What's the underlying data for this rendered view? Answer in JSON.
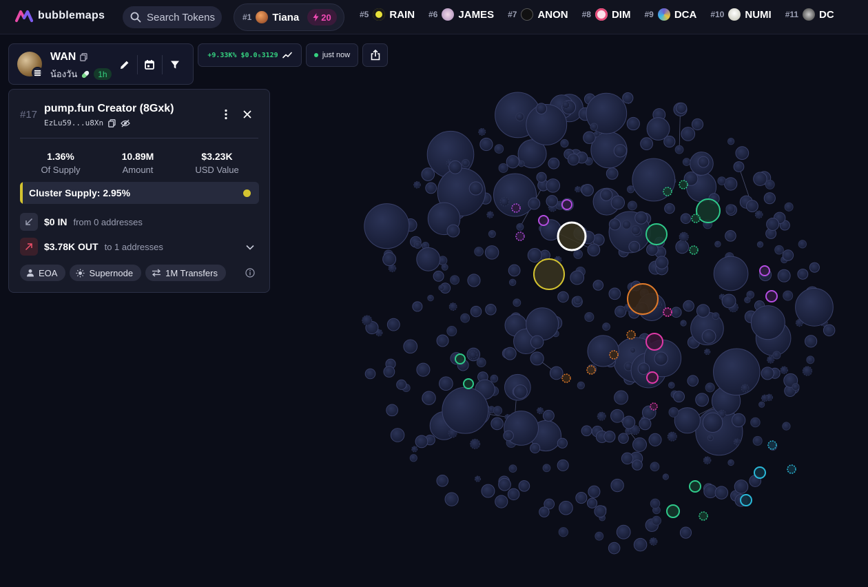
{
  "app": {
    "name": "bubblemaps"
  },
  "search": {
    "label": "Search Tokens"
  },
  "trending": [
    {
      "rank": "#1",
      "name": "Tiana",
      "boost": "20",
      "color": "#c96a3a"
    },
    {
      "rank": "#5",
      "name": "RAIN",
      "color": "#e8e23a"
    },
    {
      "rank": "#6",
      "name": "JAMES",
      "color": "#b9a8cc"
    },
    {
      "rank": "#7",
      "name": "ANON",
      "color": "#1a1a1a"
    },
    {
      "rank": "#8",
      "name": "DIM",
      "color": "#e54c7a"
    },
    {
      "rank": "#9",
      "name": "DCA",
      "color": "#6b5fd1"
    },
    {
      "rank": "#10",
      "name": "NUMI",
      "color": "#d8d8d0"
    },
    {
      "rank": "#11",
      "name": "DC",
      "color": "#5a5a5a"
    }
  ],
  "token": {
    "symbol": "WAN",
    "name": "น้องวัน",
    "age": "1h",
    "change": "+9.33K%",
    "price": "$0.0₅3129",
    "updated": "just now"
  },
  "wallet": {
    "index": "#17",
    "label": "pump.fun Creator (8Gxk)",
    "address": "EzLu59...u8Xn",
    "stats": [
      {
        "value": "1.36%",
        "label": "Of Supply"
      },
      {
        "value": "10.89M",
        "label": "Amount"
      },
      {
        "value": "$3.23K",
        "label": "USD Value"
      }
    ],
    "cluster_supply": "Cluster Supply: 2.95%",
    "in_amount": "$0 IN",
    "in_detail": "from 0 addresses",
    "out_amount": "$3.78K OUT",
    "out_detail": "to 1 addresses",
    "tags": [
      "EOA",
      "Supernode",
      "1M Transfers"
    ]
  },
  "colors": {
    "accent_yellow": "#d4c330",
    "accent_orange": "#e07a2a",
    "accent_pink": "#e03aa8",
    "accent_green": "#2fc98a",
    "accent_purple": "#b34de0",
    "accent_cyan": "#2ab8d8",
    "positive": "#35d07f"
  }
}
